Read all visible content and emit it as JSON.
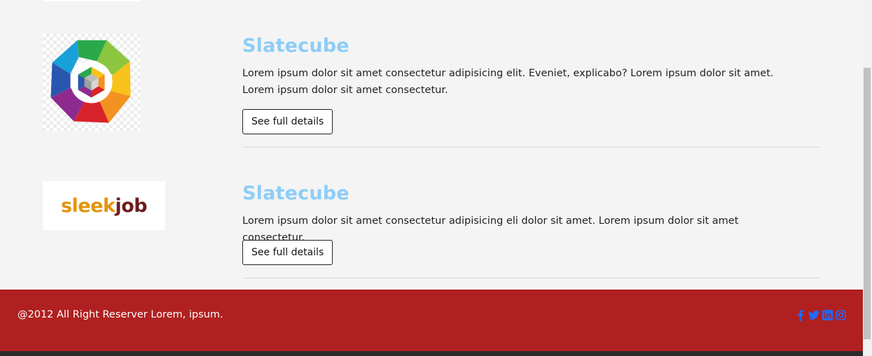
{
  "cards": [
    {
      "title": "Slatecube",
      "description": "Lorem ipsum dolor sit amet consectetur adipisicing elit. Eveniet, explicabo? Lorem ipsum dolor sit amet. Lorem ipsum dolor sit amet consectetur.",
      "button_label": "See full details",
      "logo_icon": "slatecube-logo-icon"
    },
    {
      "title": "Slatecube",
      "description": "Lorem ipsum dolor sit amet consectetur adipisicing eli dolor sit amet. Lorem ipsum dolor sit amet consectetur.",
      "button_label": "See full details",
      "logo_icon": "sleekjob-logo",
      "logo_text_a": "sleek",
      "logo_text_b": "job"
    }
  ],
  "footer": {
    "copyright": "@2012 All Right Reserver Lorem, ipsum.",
    "social_icons": [
      "facebook-icon",
      "twitter-icon",
      "linkedin-icon",
      "instagram-icon"
    ],
    "social_color": "#1f6bff"
  },
  "colors": {
    "title": "#8ecdf7",
    "footer_bg": "#b02020",
    "page_bg": "#f4f4f4"
  }
}
